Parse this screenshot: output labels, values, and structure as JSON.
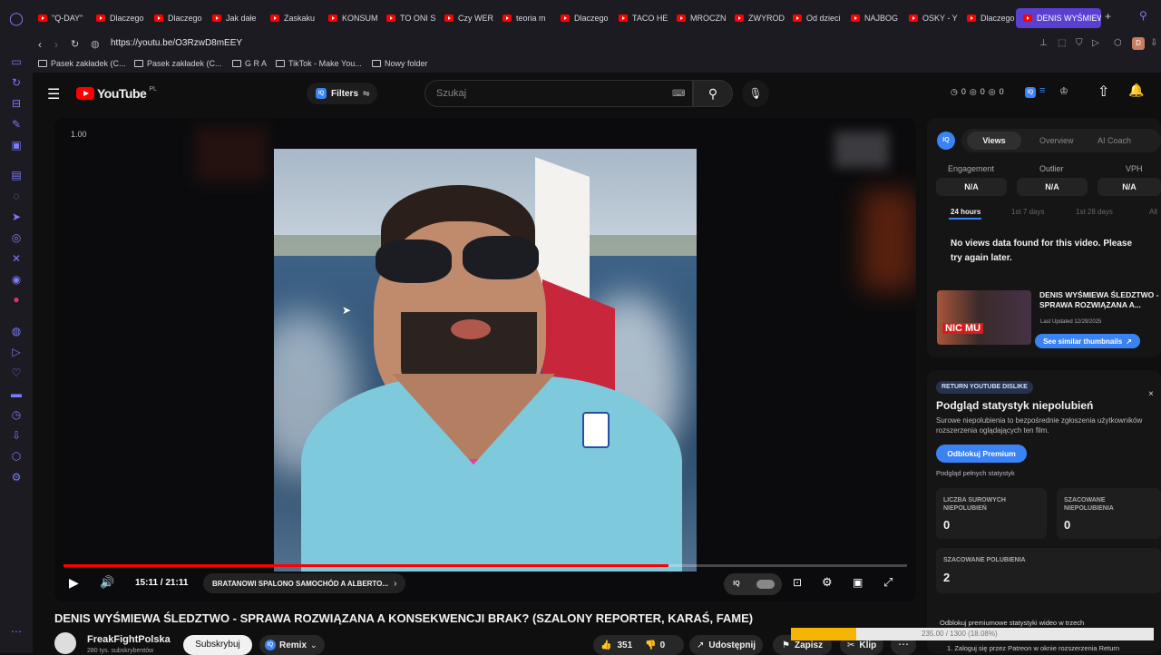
{
  "tabs": [
    {
      "label": "\"Q-DAY\""
    },
    {
      "label": "Dlaczego"
    },
    {
      "label": "Dlaczego"
    },
    {
      "label": "Jak dałe"
    },
    {
      "label": "Zaskaku"
    },
    {
      "label": "KONSUM"
    },
    {
      "label": "TO ONI S"
    },
    {
      "label": "Czy WER"
    },
    {
      "label": "teoria m"
    },
    {
      "label": "Dlaczego"
    },
    {
      "label": "TACO HE"
    },
    {
      "label": "MROCZN"
    },
    {
      "label": "ZWYROD"
    },
    {
      "label": "Od dzieci"
    },
    {
      "label": "NAJBOG"
    },
    {
      "label": "OSKY - Y"
    },
    {
      "label": "Dlaczego"
    },
    {
      "label": "DENIS WYŚMIEW"
    }
  ],
  "address": {
    "url": "https://youtu.be/O3RzwD8mEEY"
  },
  "bookmarks": [
    {
      "label": "Pasek zakładek (C..."
    },
    {
      "label": "Pasek zakładek (C..."
    },
    {
      "label": "G R A"
    },
    {
      "label": "TikTok - Make You..."
    },
    {
      "label": "Nowy folder"
    }
  ],
  "youtube": {
    "logo": "YouTube",
    "logo_region": "PL",
    "filters_label": "Filters",
    "search_placeholder": "Szukaj",
    "stats": {
      "a": "0",
      "b": "0",
      "c": "0"
    }
  },
  "player": {
    "speed": "1.00",
    "time": "15:11 / 21:11",
    "chapter": "BRATANOWI SPALONO SAMOCHÓD A ALBERTO...",
    "progress_fraction": 0.717
  },
  "video": {
    "title": "DENIS WYŚMIEWA ŚLEDZTWO - SPRAWA ROZWIĄZANA A KONSEKWENCJI BRAK? (SZALONY REPORTER, KARAŚ, FAME)",
    "channel": "FreakFightPolska",
    "subscribers": "280 tys. subskrybentów",
    "subscribe_label": "Subskrybuj",
    "remix_label": "Remix",
    "likes": "351",
    "dislikes": "0",
    "share_label": "Udostępnij",
    "save_label": "Zapisz",
    "clip_label": "Klip"
  },
  "vidiq": {
    "tabs": [
      "Views",
      "Overview",
      "AI Coach"
    ],
    "metrics": [
      {
        "label": "Engagement",
        "value": "N/A"
      },
      {
        "label": "Outlier",
        "value": "N/A"
      },
      {
        "label": "VPH",
        "value": "N/A"
      }
    ],
    "ranges": [
      "24 hours",
      "1st 7 days",
      "1st 28 days",
      "All"
    ],
    "empty_message": "No views data found for this video. Please try again later.",
    "thumb_caption": "NIC MU",
    "related_title": "DENIS WYŚMIEWA ŚLEDZTWO - SPRAWA ROZWIĄZANA A...",
    "related_updated": "Last Updated 12/29/2025",
    "similar_label": "See similar thumbnails"
  },
  "ryd": {
    "badge": "RETURN YOUTUBE DISLIKE",
    "title": "Podgląd statystyk niepolubień",
    "description": "Surowe niepolubienia to bezpośrednie zgłoszenia użytkowników rozszerzenia oglądających ten film.",
    "unlock_label": "Odblokuj Premium",
    "full_stats_label": "Podgląd pełnych statystyk",
    "cards": [
      {
        "label": "LICZBA SUROWYCH NIEPOLUBIEŃ",
        "value": "0"
      },
      {
        "label": "SZACOWANE NIEPOLUBIENIA",
        "value": "0"
      },
      {
        "label": "SZACOWANE POLUBIENIA",
        "value": "2"
      }
    ],
    "premium_text": "Odblokuj premiumowe statystyki wideo w trzech",
    "step_text": "1. Zaloguj się przez Patreon w oknie rozszerzenia Return",
    "progress_text": "235.00 / 1300 (18.08%)",
    "progress_fraction": 0.1808
  },
  "colors": {
    "accent_red": "#ff0000",
    "vidiq_blue": "#3a83f5",
    "opera_purple": "#5b3fd0"
  }
}
